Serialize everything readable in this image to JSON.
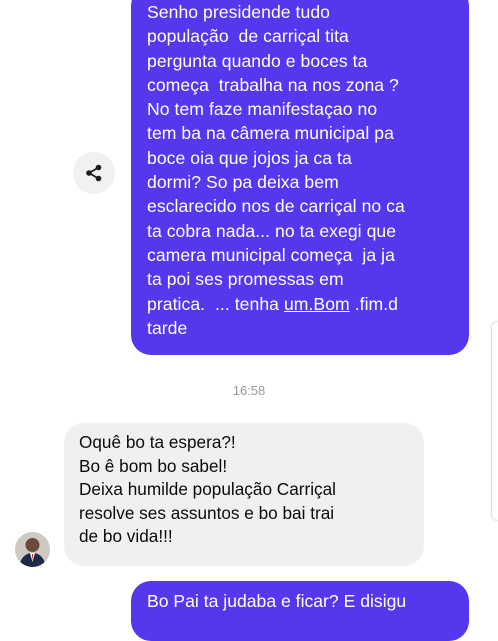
{
  "outgoing_message": {
    "lines": [
      "Senho presidende tudo",
      "população  de carriçal tita",
      "pergunta quando e boces ta",
      "começa  trabalha na nos zona ?",
      "No tem faze manifestaçao no",
      "tem ba na câmera municipal pa",
      "boce oia que jojos ja ca ta",
      "dormi? So pa deixa bem",
      "esclarecido nos de carriçal no ca",
      "ta cobra nada... no ta exegi que",
      "camera municipal começa  ja ja",
      "ta poi ses promessas em"
    ],
    "last_line_prefix": "pratica.  ... tenha ",
    "link_text": "um.Bom",
    "last_line_suffix": " .fim.d",
    "final_line": "tarde"
  },
  "share_button": {
    "icon": "share-icon"
  },
  "timestamp": "16:58",
  "incoming_message": {
    "lines": [
      "Oquê bo ta espera?!",
      "Bo ê bom bo sabel!",
      "Deixa humilde população Carriçal",
      "resolve ses assuntos e bo bai trai",
      "de bo vida!!!"
    ]
  },
  "avatar": {
    "icon": "profile-photo"
  },
  "outgoing_message_2": {
    "partial_text": "Bo Pai ta judaba e ficar? E disigu"
  },
  "colors": {
    "outgoing_bubble": "#5537ee",
    "incoming_bubble": "#f0f0f2",
    "timestamp": "#9a9a9f"
  }
}
